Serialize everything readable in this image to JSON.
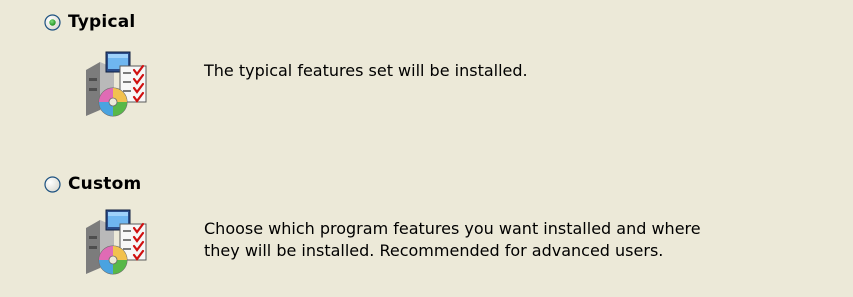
{
  "options": [
    {
      "label": "Typical",
      "selected": true,
      "description": "The typical features set will be installed.",
      "icon": "setup-package-icon"
    },
    {
      "label": "Custom",
      "selected": false,
      "description": "Choose which program features you want installed and where\nthey will be installed. Recommended for advanced users.",
      "icon": "setup-package-icon"
    }
  ],
  "colors": {
    "background": "#ECE9D8",
    "radio_border": "#1C5180",
    "radio_dot": "#21A121",
    "text": "#000000"
  }
}
